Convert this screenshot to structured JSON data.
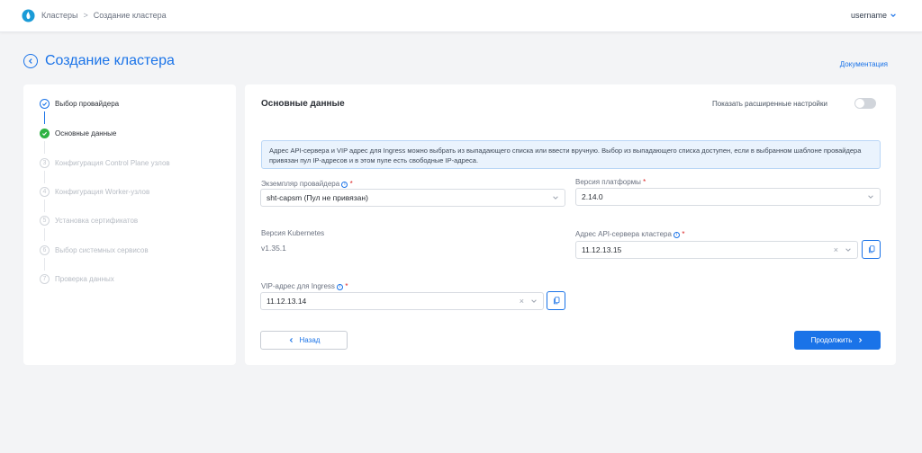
{
  "topbar": {
    "breadcrumbs": [
      "Кластеры",
      "Создание кластера"
    ],
    "username": "username"
  },
  "page": {
    "title": "Создание кластера",
    "doc_link": "Документация"
  },
  "steps": [
    {
      "label": "Выбор провайдера",
      "state": "done",
      "num": ""
    },
    {
      "label": "Основные данные",
      "state": "active",
      "num": ""
    },
    {
      "label": "Конфигурация Control Plane узлов",
      "state": "todo",
      "num": "3"
    },
    {
      "label": "Конфигурация Worker-узлов",
      "state": "todo",
      "num": "4"
    },
    {
      "label": "Установка сертификатов",
      "state": "todo",
      "num": "5"
    },
    {
      "label": "Выбор системных сервисов",
      "state": "todo",
      "num": "6"
    },
    {
      "label": "Проверка данных",
      "state": "todo",
      "num": "7"
    }
  ],
  "form": {
    "section_title": "Основные данные",
    "advanced_label": "Показать расширенные настройки",
    "info_text": "Адрес API-сервера и VIP адрес для Ingress можно выбрать из выпадающего списка или ввести вручную. Выбор из выпадающего списка доступен, если в выбранном шаблоне провайдера привязан пул IP-адресов и в этом пуле есть свободные IP-адреса.",
    "provider_label": "Экземпляр провайдера",
    "provider_value": "sht-capsm (Пул не привязан)",
    "platform_label": "Версия платформы",
    "platform_value": "2.14.0",
    "k8s_label": "Версия Kubernetes",
    "k8s_value": "v1.35.1",
    "api_label": "Адрес API-сервера кластера",
    "api_value": "11.12.13.15",
    "vip_label": "VIP-адрес для Ingress",
    "vip_value": "11.12.13.14",
    "required_mark": "*",
    "info_icon": "i",
    "clear_glyph": "×",
    "back_label": "Назад",
    "next_label": "Продолжить"
  },
  "colors": {
    "accent": "#1a73e8",
    "success": "#2fb344",
    "required": "#dc2626"
  }
}
